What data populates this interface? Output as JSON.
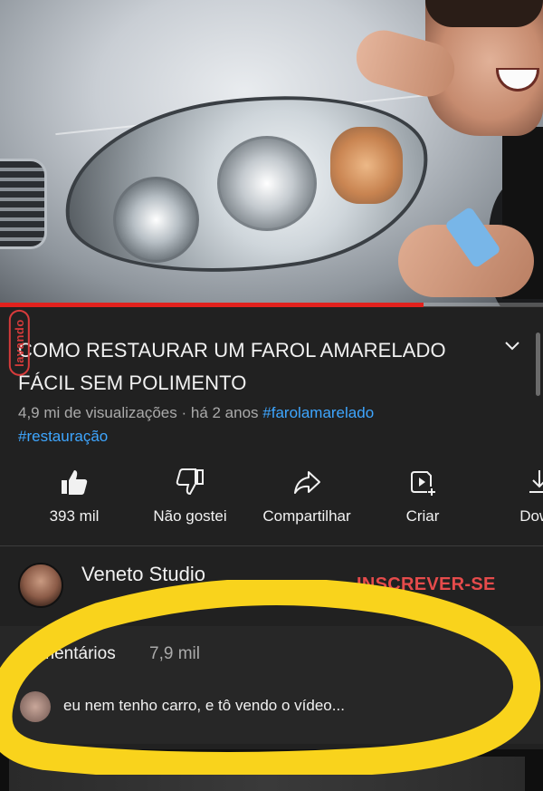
{
  "video": {
    "watermark": "lavando",
    "progress_percent": 78
  },
  "details": {
    "title": "COMO RESTAURAR UM FAROL AMARELADO FÁCIL SEM POLIMENTO",
    "views": "4,9 mi de visualizações",
    "separator": " · ",
    "age": "há 2 anos",
    "hashtags": [
      "#farolamarelado",
      "#restauração"
    ]
  },
  "actions": [
    {
      "label": "393 mil",
      "icon": "thumbs-up-filled-icon"
    },
    {
      "label": "Não gostei",
      "icon": "thumbs-down-icon"
    },
    {
      "label": "Compartilhar",
      "icon": "share-icon"
    },
    {
      "label": "Criar",
      "icon": "create-icon"
    },
    {
      "label": "Down",
      "icon": "download-icon"
    }
  ],
  "channel": {
    "name": "Veneto Studio",
    "subscribe_label": "INSCREVER-SE"
  },
  "comments": {
    "heading": "Comentários",
    "count": "7,9 mil",
    "top_comment": "eu nem tenho carro, e tô vendo o vídeo..."
  },
  "colors": {
    "accent_red": "#e1211d",
    "link_blue": "#3ea6ff",
    "highlight_yellow": "#f9d31c",
    "subscribe_red": "#e54b4b"
  }
}
